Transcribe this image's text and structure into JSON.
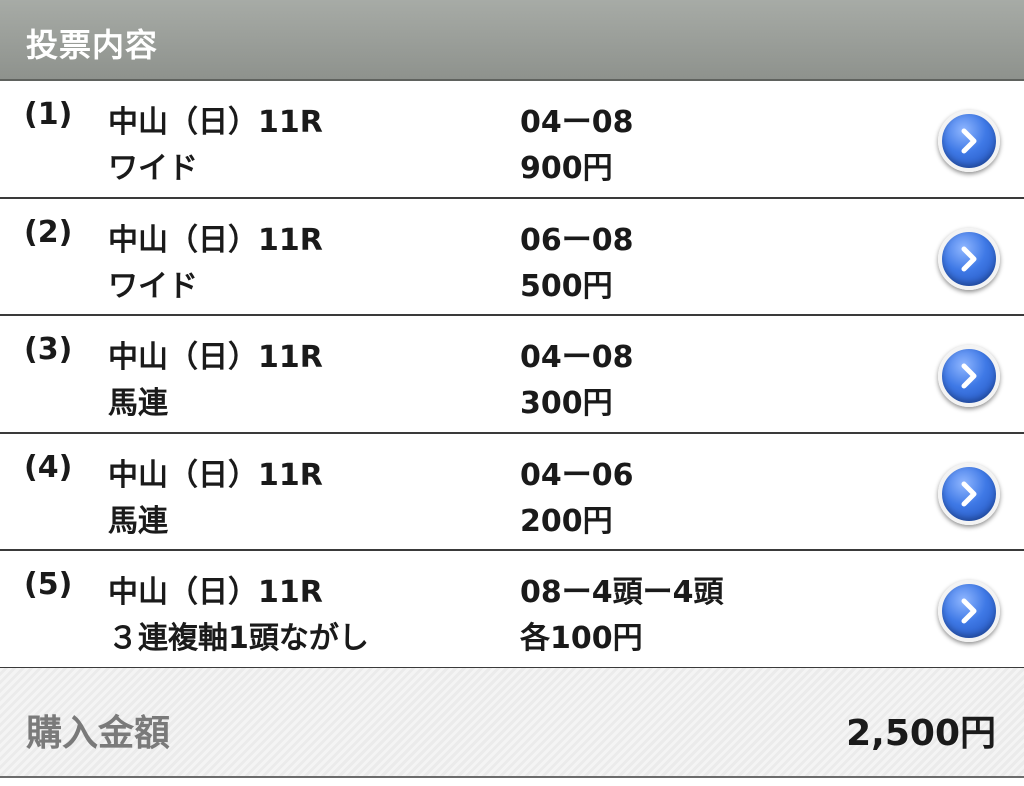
{
  "header": {
    "title": "投票内容"
  },
  "bets": [
    {
      "index": "(1)",
      "race": "中山（日）11R",
      "type": "ワイド",
      "combination": "04ー08",
      "amount": "900円"
    },
    {
      "index": "(2)",
      "race": "中山（日）11R",
      "type": "ワイド",
      "combination": "06ー08",
      "amount": "500円"
    },
    {
      "index": "(3)",
      "race": "中山（日）11R",
      "type": "馬連",
      "combination": "04ー08",
      "amount": "300円"
    },
    {
      "index": "(4)",
      "race": "中山（日）11R",
      "type": "馬連",
      "combination": "04ー06",
      "amount": "200円"
    },
    {
      "index": "(5)",
      "race": "中山（日）11R",
      "type": "３連複軸1頭ながし",
      "combination": "08ー4頭ー4頭",
      "amount": "各100円"
    }
  ],
  "row_action_icon": "chevron-right-circle-icon",
  "total": {
    "label": "購入金額",
    "value": "2,500円"
  },
  "colors": {
    "header_bg": "#9a9e99",
    "accent_button": "#3f79e6"
  }
}
